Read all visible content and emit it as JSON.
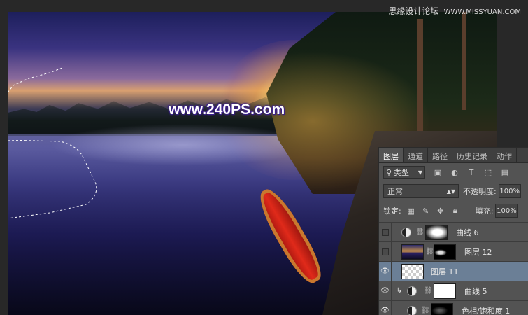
{
  "site_stamp": {
    "chinese": "思缘设计论坛",
    "url": "WWW.MISSYUAN.COM"
  },
  "canvas": {
    "watermark": "www.240PS.com"
  },
  "layers_panel": {
    "tabs": [
      {
        "label": "图层",
        "active": true
      },
      {
        "label": "通道",
        "active": false
      },
      {
        "label": "路径",
        "active": false
      },
      {
        "label": "历史记录",
        "active": false
      },
      {
        "label": "动作",
        "active": false
      }
    ],
    "filter": {
      "kind_label": "类型",
      "icons": [
        "image-filter-icon",
        "adjustment-filter-icon",
        "type-filter-icon",
        "shape-filter-icon",
        "smart-object-filter-icon"
      ]
    },
    "blend_mode": "正常",
    "opacity_label": "不透明度:",
    "opacity_value": "100%",
    "lock_label": "锁定:",
    "fill_label": "填充:",
    "fill_value": "100%",
    "layers": [
      {
        "name": "曲线 6",
        "visible": false,
        "selected": false,
        "type": "adjustment",
        "mask": "mask-cloud"
      },
      {
        "name": "图层 12",
        "visible": false,
        "selected": false,
        "type": "pixel",
        "mask": "mask-dark"
      },
      {
        "name": "图层 11",
        "visible": true,
        "selected": true,
        "type": "pixel"
      },
      {
        "name": "曲线 5",
        "visible": true,
        "selected": false,
        "type": "adjustment",
        "clipped": true,
        "mask": "white"
      },
      {
        "name": "色相/饱和度 1",
        "visible": true,
        "selected": false,
        "type": "adjustment",
        "mask": "mask-black"
      }
    ]
  }
}
